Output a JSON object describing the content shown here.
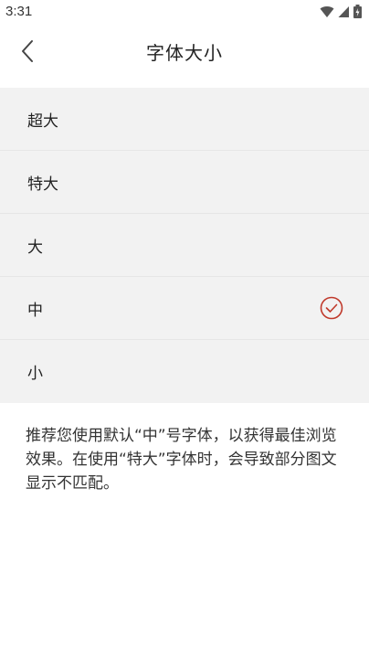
{
  "status_bar": {
    "time": "3:31",
    "icons": [
      "wifi-icon",
      "cell-signal-icon",
      "battery-icon"
    ]
  },
  "header": {
    "back_icon": "chevron-left-icon",
    "title": "字体大小"
  },
  "options": [
    {
      "label": "超大",
      "selected": false
    },
    {
      "label": "特大",
      "selected": false
    },
    {
      "label": "大",
      "selected": false
    },
    {
      "label": "中",
      "selected": true
    },
    {
      "label": "小",
      "selected": false
    }
  ],
  "hint": "推荐您使用默认“中”号字体，以获得最佳浏览效果。在使用“特大”字体时，会导致部分图文显示不匹配。",
  "colors": {
    "accent": "#c0392b",
    "list_background": "#f2f2f2"
  }
}
